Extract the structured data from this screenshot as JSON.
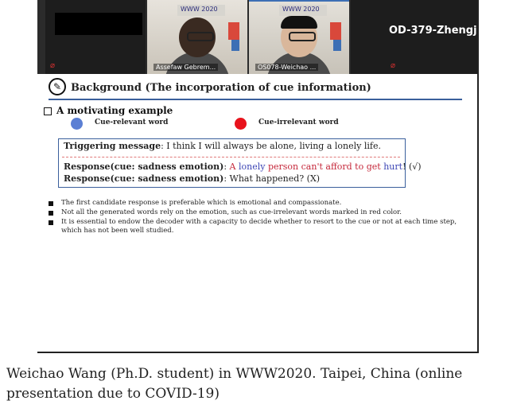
{
  "meeting": {
    "participants": [
      {
        "name": ""
      },
      {
        "name": "Assefaw Gebrem..."
      },
      {
        "name": "OS078-Weichao ..."
      },
      {
        "name": "OD-379-Zhengj..."
      }
    ],
    "banner_text": "WWW 2020"
  },
  "slide": {
    "title": "Background (The incorporation of cue information)",
    "section": "A motivating example",
    "legend": {
      "relevant": "Cue-relevant word",
      "irrelevant": "Cue-irrelevant word"
    },
    "trigger": {
      "label": "Triggering message",
      "text": ": I think I will always be alone, living a lonely life."
    },
    "response1": {
      "label": "Response(cue: sadness emotion)",
      "sep": ": ",
      "w1": "A",
      "w2": "lonely",
      "w3": "person",
      "w4": "can't afford to get",
      "w5": "hurt",
      "end": "! (√)"
    },
    "response2": {
      "label": "Response(cue: sadness emotion)",
      "text": ": What happened?   (X)"
    },
    "bullets": [
      "The first candidate response is preferable which is emotional and compassionate.",
      "Not all the generated words rely on the emotion, such as cue-irrelevant words marked in red color.",
      "It is essential to endow the decoder with a capacity to decide whether to resort to the cue or not at each time step, which has not been well studied."
    ]
  },
  "caption": "Weichao Wang (Ph.D. student) in WWW2020. Taipei, China (online presentation due to COVID-19)",
  "colors": {
    "relevant": "#5b7fd4",
    "irrelevant": "#e8131c",
    "rule": "#3a5f9c"
  }
}
